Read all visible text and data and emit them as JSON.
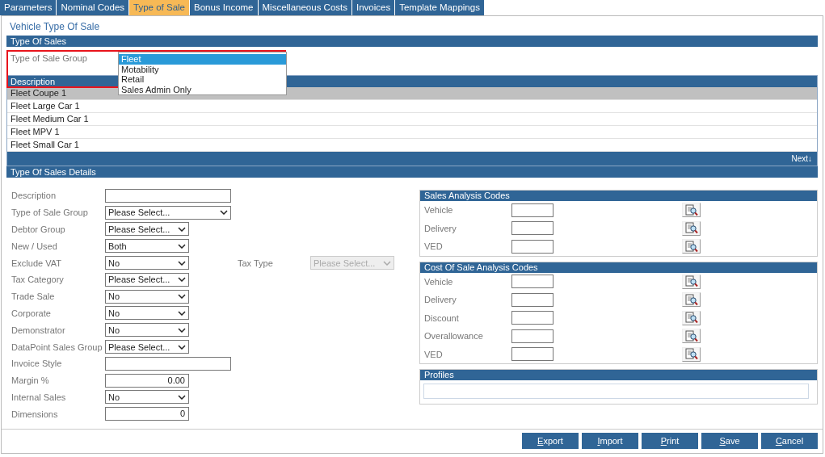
{
  "tabs": [
    {
      "label": "Parameters",
      "selected": false
    },
    {
      "label": "Nominal Codes",
      "selected": false
    },
    {
      "label": "Type of Sale",
      "selected": true
    },
    {
      "label": "Bonus Income",
      "selected": false
    },
    {
      "label": "Miscellaneous Costs",
      "selected": false
    },
    {
      "label": "Invoices",
      "selected": false
    },
    {
      "label": "Template Mappings",
      "selected": false
    }
  ],
  "page_title": "Vehicle Type Of Sale",
  "type_of_sales": {
    "header": "Type Of Sales",
    "group_label": "Type of Sale Group",
    "dropdown": {
      "expanded": true,
      "options": [
        {
          "label": "Fleet",
          "selected": true
        },
        {
          "label": "Motability",
          "selected": false
        },
        {
          "label": "Retail",
          "selected": false
        },
        {
          "label": "Sales Admin Only",
          "selected": false
        }
      ]
    },
    "table": {
      "columns": [
        "Description"
      ],
      "rows": [
        {
          "description": "Fleet Coupe 1",
          "selected": true
        },
        {
          "description": "Fleet Large Car 1",
          "selected": false
        },
        {
          "description": "Fleet Medium Car 1",
          "selected": false
        },
        {
          "description": "Fleet MPV 1",
          "selected": false
        },
        {
          "description": "Fleet Small Car 1",
          "selected": false
        }
      ],
      "next_label": "Next↓"
    }
  },
  "details": {
    "header": "Type Of Sales Details",
    "fields": [
      {
        "label": "Description",
        "kind": "wide-text"
      },
      {
        "label": "Type of Sale Group",
        "kind": "wide-select",
        "value": "Please Select..."
      },
      {
        "label": "Debtor Group",
        "kind": "select",
        "value": "Please Select..."
      },
      {
        "label": "New / Used",
        "kind": "select",
        "value": "Both"
      },
      {
        "label": "Exclude VAT",
        "kind": "select",
        "value": "No",
        "side": {
          "label": "Tax Type",
          "value": "Please Select...",
          "disabled": true
        }
      },
      {
        "label": "Tax Category",
        "kind": "select",
        "value": "Please Select..."
      },
      {
        "label": "Trade Sale",
        "kind": "select",
        "value": "No"
      },
      {
        "label": "Corporate",
        "kind": "select",
        "value": "No"
      },
      {
        "label": "Demonstrator",
        "kind": "select",
        "value": "No"
      },
      {
        "label": "DataPoint Sales Group",
        "kind": "select",
        "value": "Please Select..."
      },
      {
        "label": "Invoice Style",
        "kind": "wide-text"
      },
      {
        "label": "Margin %",
        "kind": "number",
        "value": "0.00"
      },
      {
        "label": "Internal Sales",
        "kind": "select",
        "value": "No"
      },
      {
        "label": "Dimensions",
        "kind": "number",
        "value": "0"
      }
    ]
  },
  "analysis_sections": [
    {
      "title": "Sales Analysis Codes",
      "rows": [
        {
          "label": "Vehicle"
        },
        {
          "label": "Delivery"
        },
        {
          "label": "VED"
        }
      ]
    },
    {
      "title": "Cost Of Sale Analysis Codes",
      "rows": [
        {
          "label": "Vehicle"
        },
        {
          "label": "Delivery"
        },
        {
          "label": "Discount"
        },
        {
          "label": "Overallowance"
        },
        {
          "label": "VED"
        }
      ]
    }
  ],
  "profiles": {
    "title": "Profiles"
  },
  "buttons": [
    {
      "label": "Export"
    },
    {
      "label": "Import"
    },
    {
      "label": "Print"
    },
    {
      "label": "Save"
    },
    {
      "label": "Cancel"
    }
  ]
}
